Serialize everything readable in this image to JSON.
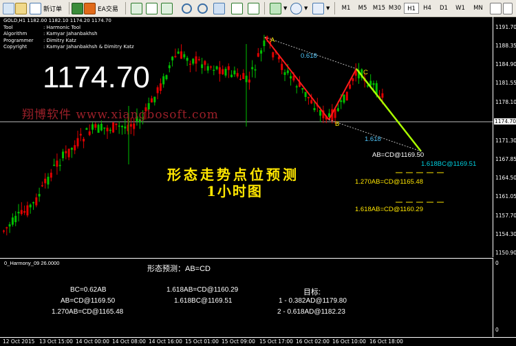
{
  "toolbar": {
    "new_order": "新订单",
    "ea_trading": "EA交易",
    "timeframes": [
      "M1",
      "M5",
      "M15",
      "M30",
      "H1",
      "H4",
      "D1",
      "W1",
      "MN"
    ],
    "active_timeframe": "H1"
  },
  "chart": {
    "header": "GOLD,H1  1182.00 1182.10 1174.20 1174.70",
    "info": [
      {
        "k": "Tool",
        "v": ": Harmonic Tool"
      },
      {
        "k": "Algorithm",
        "v": ": Kamyar Jahanbakhsh"
      },
      {
        "k": "Programmer",
        "v": ": Dimitry Katz"
      },
      {
        "k": "Copyright",
        "v": ": Kamyar Jahanbakhsh & Dimitry Katz"
      }
    ],
    "big_price": "1174.70",
    "watermark": "翔博软件 www.xiangbosoft.com",
    "title_cn": "形态走势点位预测",
    "subtitle_cn": "1小时图",
    "points": {
      "A": "A",
      "B": "B",
      "C": "C"
    },
    "ratio_ac": "0.618",
    "ratio_bd": "1.618",
    "targets": {
      "abcd": "AB=CD@1169.50",
      "bc1618": "1.618BC@1169.51",
      "ab1270": "1.270AB=CD@1165.48",
      "ab1618": "1.618AB=CD@1160.29"
    },
    "price_labels": [
      "1191.70",
      "1188.35",
      "1184.90",
      "1181.55",
      "1178.10",
      "1174.70",
      "1171.30",
      "1167.85",
      "1164.50",
      "1161.05",
      "1157.70",
      "1154.30",
      "1150.90"
    ],
    "current_price_tag": "1174.70"
  },
  "indicator": {
    "name": "0_Harmony_09 26.0000",
    "pattern_title": "形态预测：AB=CD",
    "col1": [
      "BC=0.62AB",
      "AB=CD@1169.50",
      "1.270AB=CD@1165.48"
    ],
    "col2": [
      "1.618AB=CD@1160.29",
      "1.618BC@1169.51"
    ],
    "col3_title": "目标:",
    "col3": [
      "1 - 0.382AD@1179.80",
      "2 - 0.618AD@1182.23"
    ],
    "scale_top": "0",
    "scale_bottom": "0"
  },
  "time_labels": [
    "12 Oct 2015",
    "13 Oct 15:00",
    "14 Oct 00:00",
    "14 Oct 08:00",
    "14 Oct 16:00",
    "15 Oct 01:00",
    "15 Oct 09:00",
    "15 Oct 17:00",
    "16 Oct 02:00",
    "16 Oct 10:00",
    "16 Oct 18:00"
  ],
  "colors": {
    "bull": "#00c000",
    "bear": "#e00000",
    "pattern": "#ff1a1a",
    "projection": "#aaff00",
    "cyan": "#00bcd4"
  }
}
